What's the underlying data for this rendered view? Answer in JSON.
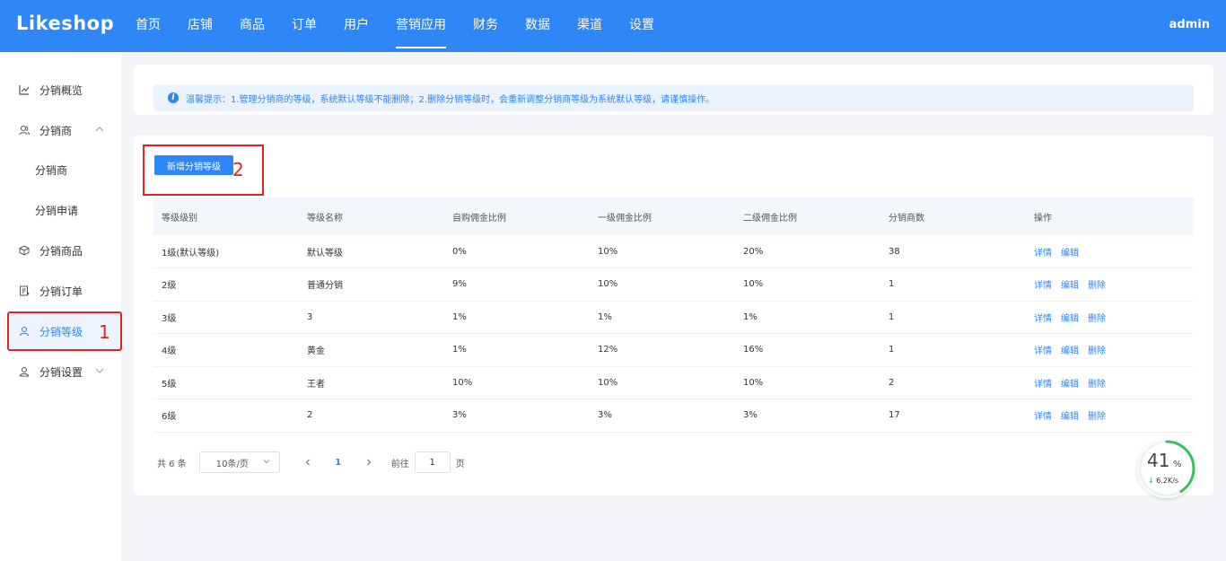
{
  "header": {
    "logo": "Likeshop",
    "nav": [
      "首页",
      "店铺",
      "商品",
      "订单",
      "用户",
      "营销应用",
      "财务",
      "数据",
      "渠道",
      "设置"
    ],
    "active_nav": "营销应用",
    "user": "admin"
  },
  "sidebar": {
    "items": [
      {
        "label": "分销概览",
        "icon": "line-chart-icon"
      },
      {
        "label": "分销商",
        "icon": "users-icon"
      },
      {
        "label": "分销商"
      },
      {
        "label": "分销申请"
      },
      {
        "label": "分销商品",
        "icon": "box-icon"
      },
      {
        "label": "分销订单",
        "icon": "order-icon"
      },
      {
        "label": "分销等级",
        "icon": "user-icon"
      },
      {
        "label": "分销设置",
        "icon": "user-settings-icon"
      }
    ],
    "annotation_1": "1"
  },
  "tip": {
    "text": "温馨提示：1.管理分销商的等级，系统默认等级不能删除；2.删除分销等级时，会重新调整分销商等级为系统默认等级，请谨慎操作。"
  },
  "toolbar": {
    "add_label": "新增分销等级",
    "annotation_2": "2"
  },
  "table": {
    "headers": [
      "等级级别",
      "等级名称",
      "自购佣金比例",
      "一级佣金比例",
      "二级佣金比例",
      "分销商数",
      "操作"
    ],
    "rows": [
      {
        "level": "1级(默认等级)",
        "name": "默认等级",
        "self": "0%",
        "first": "10%",
        "second": "20%",
        "count": "38",
        "ops": [
          "详情",
          "编辑"
        ]
      },
      {
        "level": "2级",
        "name": "普通分销",
        "self": "9%",
        "first": "10%",
        "second": "10%",
        "count": "1",
        "ops": [
          "详情",
          "编辑",
          "删除"
        ]
      },
      {
        "level": "3级",
        "name": "3",
        "self": "1%",
        "first": "1%",
        "second": "1%",
        "count": "1",
        "ops": [
          "详情",
          "编辑",
          "删除"
        ]
      },
      {
        "level": "4级",
        "name": "黄金",
        "self": "1%",
        "first": "12%",
        "second": "16%",
        "count": "1",
        "ops": [
          "详情",
          "编辑",
          "删除"
        ]
      },
      {
        "level": "5级",
        "name": "王者",
        "self": "10%",
        "first": "10%",
        "second": "10%",
        "count": "2",
        "ops": [
          "详情",
          "编辑",
          "删除"
        ]
      },
      {
        "level": "6级",
        "name": "2",
        "self": "3%",
        "first": "3%",
        "second": "3%",
        "count": "17",
        "ops": [
          "详情",
          "编辑",
          "删除"
        ]
      }
    ]
  },
  "pagination": {
    "total": "共 6 条",
    "page_size": "10条/页",
    "current_page": "1",
    "goto_label": "前往",
    "goto_value": "1",
    "page_unit": "页"
  },
  "speed_widget": {
    "percent": "41",
    "percent_sign": "%",
    "speed": "6.2K/s",
    "fraction": 0.41
  },
  "colors": {
    "primary": "#2f86f6",
    "annotation_red": "#e02424"
  }
}
